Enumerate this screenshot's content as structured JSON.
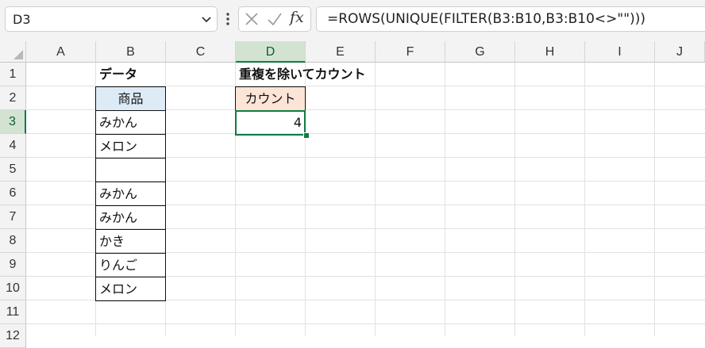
{
  "namebox": {
    "value": "D3"
  },
  "formula": {
    "value": "=ROWS(UNIQUE(FILTER(B3:B10,B3:B10<>\"\")))"
  },
  "columns": [
    "A",
    "B",
    "C",
    "D",
    "E",
    "F",
    "G",
    "H",
    "I",
    "J"
  ],
  "rows": [
    "1",
    "2",
    "3",
    "4",
    "5",
    "6",
    "7",
    "8",
    "9",
    "10",
    "11",
    "12"
  ],
  "selected": {
    "column": "D",
    "row": "3"
  },
  "cells": {
    "B1": "データ",
    "D1": "重複を除いてカウント",
    "B2": "商品",
    "D2": "カウント",
    "B3": "みかん",
    "D3": "4",
    "B4": "メロン",
    "B5": "",
    "B6": "みかん",
    "B7": "みかん",
    "B8": "かき",
    "B9": "りんご",
    "B10": "メロン"
  },
  "colors": {
    "header_b_fill": "#ddebf7",
    "header_d_fill": "#fce4d6",
    "selection": "#107c41"
  },
  "icons": [
    "chevron-down-icon",
    "more-options-icon",
    "cancel-icon",
    "enter-icon",
    "fx-icon",
    "select-all-icon"
  ]
}
